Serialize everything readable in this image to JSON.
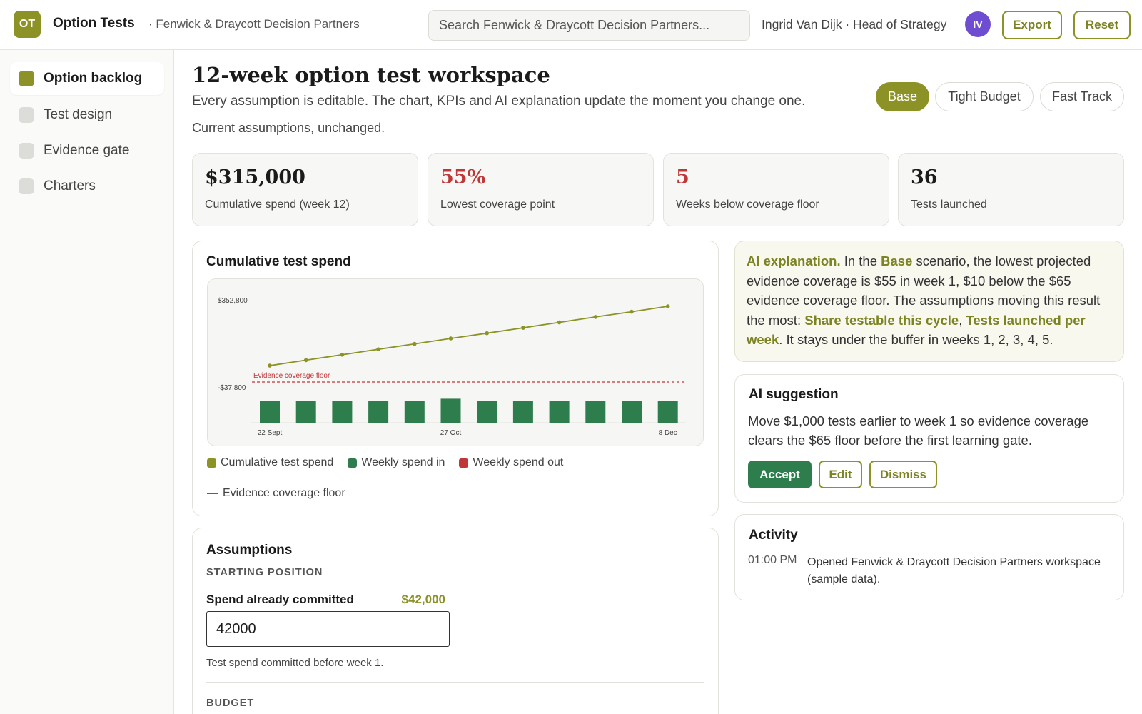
{
  "header": {
    "logo_text": "OT",
    "app_title": "Option Tests",
    "org": "· Fenwick & Draycott Decision Partners",
    "search_placeholder": "Search Fenwick & Draycott Decision Partners...",
    "user": "Ingrid Van Dijk · Head of Strategy",
    "avatar_initials": "IV",
    "export_label": "Export",
    "reset_label": "Reset"
  },
  "sidebar": {
    "items": [
      {
        "label": "Option backlog",
        "active": true
      },
      {
        "label": "Test design",
        "active": false
      },
      {
        "label": "Evidence gate",
        "active": false
      },
      {
        "label": "Charters",
        "active": false
      }
    ]
  },
  "main": {
    "title": "12-week option test workspace",
    "subtitle": "Every assumption is editable. The chart, KPIs and AI explanation update the moment you change one.",
    "status": "Current assumptions, unchanged."
  },
  "scenarios": [
    {
      "label": "Base",
      "active": true
    },
    {
      "label": "Tight Budget",
      "active": false
    },
    {
      "label": "Fast Track",
      "active": false
    }
  ],
  "kpis": [
    {
      "value": "$315,000",
      "label": "Cumulative spend (week 12)",
      "color": "#1b1b1b"
    },
    {
      "value": "55%",
      "label": "Lowest coverage point",
      "color": "#c0373a"
    },
    {
      "value": "5",
      "label": "Weeks below coverage floor",
      "color": "#c0373a"
    },
    {
      "value": "36",
      "label": "Tests launched",
      "color": "#1b1b1b"
    }
  ],
  "chart": {
    "title": "Cumulative test spend",
    "legend": {
      "cumulative": "Cumulative test spend",
      "weekly_in": "Weekly spend in",
      "weekly_out": "Weekly spend out",
      "floor": "Evidence coverage floor"
    },
    "floor_label": "Evidence coverage floor"
  },
  "chart_data": {
    "type": "line",
    "title": "Cumulative test spend",
    "x_tick_labels": [
      "22 Sept",
      "27 Oct",
      "8 Dec"
    ],
    "y_tick_labels": [
      "$352,800",
      "-$37,800"
    ],
    "ylim": [
      -37800,
      352800
    ],
    "weeks": [
      1,
      2,
      3,
      4,
      5,
      6,
      7,
      8,
      9,
      10,
      11,
      12
    ],
    "series": [
      {
        "name": "Cumulative test spend",
        "type": "line",
        "color": "#8c9226",
        "values": [
          42000,
          67000,
          92000,
          117000,
          142000,
          167000,
          191000,
          216000,
          241000,
          266000,
          290000,
          315000
        ]
      },
      {
        "name": "Weekly spend in",
        "type": "bar",
        "color": "#2e7d4d",
        "values": [
          25000,
          25000,
          25000,
          25000,
          25000,
          28000,
          25000,
          25000,
          25000,
          25000,
          25000,
          25000
        ]
      },
      {
        "name": "Weekly spend out",
        "type": "bar",
        "color": "#c0373a",
        "values": [
          0,
          0,
          0,
          0,
          0,
          0,
          0,
          0,
          0,
          0,
          0,
          0
        ]
      }
    ],
    "floor": {
      "name": "Evidence coverage floor",
      "value": 0,
      "color": "#c0373a"
    },
    "legend": "bottom",
    "grid": false
  },
  "ai_explanation": {
    "lead": "AI explanation.",
    "t1": " In the ",
    "scenario": "Base",
    "t2": " scenario, the lowest projected evidence coverage is $55 in week 1, $10 below the $65 evidence coverage floor. The assumptions moving this result the most: ",
    "driver1": "Share testable this cycle",
    "t3": ", ",
    "driver2": "Tests launched per week",
    "t4": ". It stays under the buffer in weeks 1, 2, 3, 4, 5."
  },
  "suggestion": {
    "title": "AI suggestion",
    "text": "Move $1,000 tests earlier to week 1 so evidence coverage clears the $65 floor before the first learning gate.",
    "accept": "Accept",
    "edit": "Edit",
    "dismiss": "Dismiss"
  },
  "activity": {
    "title": "Activity",
    "items": [
      {
        "time": "01:00 PM",
        "text": "Opened Fenwick & Draycott Decision Partners workspace (sample data)."
      }
    ]
  },
  "assumptions": {
    "title": "Assumptions",
    "section1": "STARTING POSITION",
    "field_label": "Spend already committed",
    "field_display": "$42,000",
    "field_value": "42000",
    "field_help": "Test spend committed before week 1.",
    "section2": "BUDGET"
  }
}
